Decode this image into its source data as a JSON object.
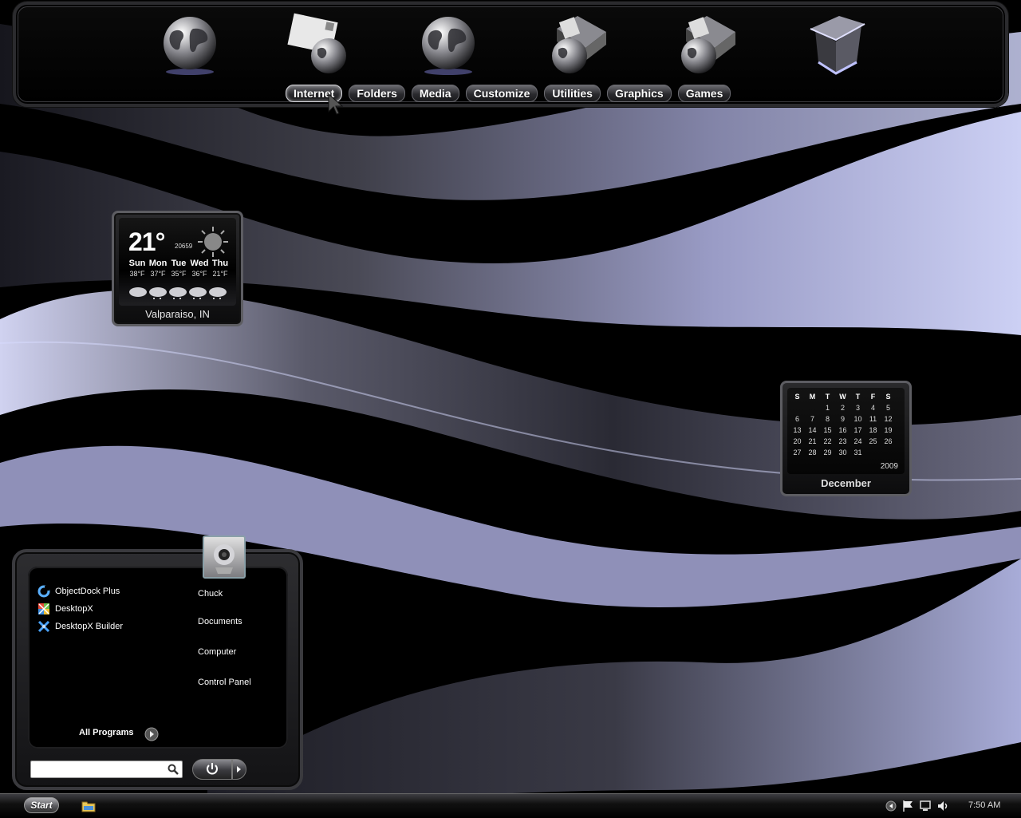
{
  "colors": {
    "accent": "#c8c8ff",
    "wave_light": "#b4b8e8",
    "wave_dark": "#2a2a36",
    "background": "#000000"
  },
  "dock": {
    "icons": [
      {
        "name": "globe-icon"
      },
      {
        "name": "mail-globe-icon"
      },
      {
        "name": "globe-icon"
      },
      {
        "name": "folder-globe-icon"
      },
      {
        "name": "folder-globe-icon"
      },
      {
        "name": "recycle-bin-icon"
      }
    ],
    "tabs": [
      "Internet",
      "Folders",
      "Media",
      "Customize",
      "Utilities",
      "Graphics",
      "Games"
    ],
    "active_tab": "Internet"
  },
  "weather": {
    "temperature": "21°",
    "code": "20659",
    "days": [
      {
        "name": "Sun",
        "temp": "38°F"
      },
      {
        "name": "Mon",
        "temp": "37°F"
      },
      {
        "name": "Tue",
        "temp": "35°F"
      },
      {
        "name": "Wed",
        "temp": "36°F"
      },
      {
        "name": "Thu",
        "temp": "21°F"
      }
    ],
    "city": "Valparaiso, IN"
  },
  "calendar": {
    "weekdays": [
      "S",
      "M",
      "T",
      "W",
      "T",
      "F",
      "S"
    ],
    "weeks": [
      [
        "",
        "",
        "1",
        "2",
        "3",
        "4",
        "5"
      ],
      [
        "6",
        "7",
        "8",
        "9",
        "10",
        "11",
        "12"
      ],
      [
        "13",
        "14",
        "15",
        "16",
        "17",
        "18",
        "19"
      ],
      [
        "20",
        "21",
        "22",
        "23",
        "24",
        "25",
        "26"
      ],
      [
        "27",
        "28",
        "29",
        "30",
        "31",
        "",
        ""
      ]
    ],
    "year": "2009",
    "month": "December"
  },
  "start_menu": {
    "pinned": [
      {
        "label": "ObjectDock Plus",
        "icon": "objectdock-icon"
      },
      {
        "label": "DesktopX",
        "icon": "desktopx-icon"
      },
      {
        "label": "DesktopX Builder",
        "icon": "desktopx-builder-icon"
      }
    ],
    "all_programs": "All Programs",
    "links": {
      "user": "Chuck",
      "documents": "Documents",
      "computer": "Computer",
      "control_panel": "Control Panel"
    },
    "search_value": ""
  },
  "taskbar": {
    "start_label": "Start",
    "time": "7:50 AM"
  }
}
